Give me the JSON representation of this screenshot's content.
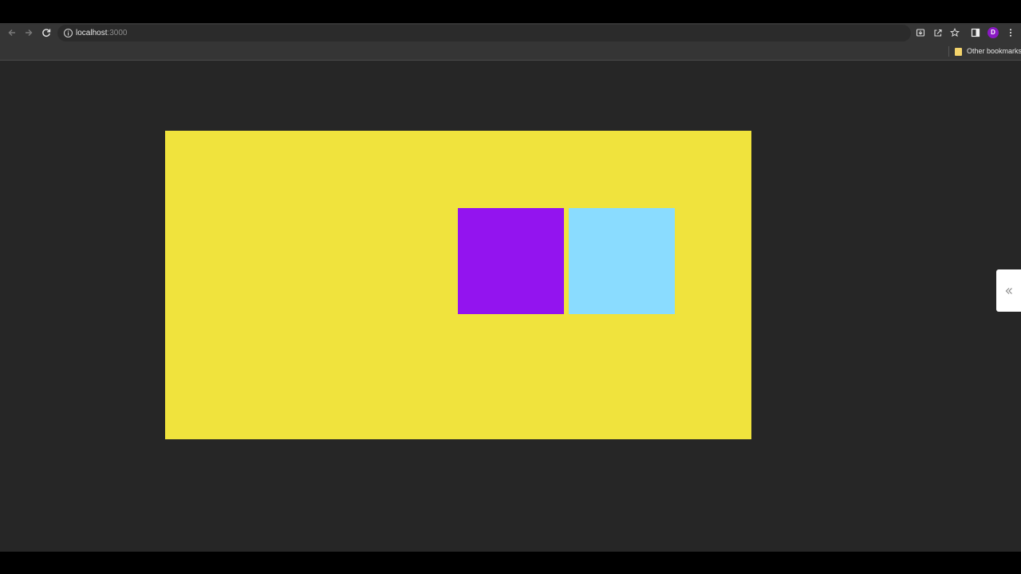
{
  "browser": {
    "url_host": "localhost",
    "url_port": ":3000",
    "bookmarks": {
      "other_label": "Other bookmarks"
    },
    "profile_initial": "D",
    "icons": {
      "back": "arrow-left-icon",
      "forward": "arrow-right-icon",
      "reload": "reload-icon",
      "site_info": "info-icon",
      "install": "install-icon",
      "share": "share-icon",
      "bookmark": "star-icon",
      "side_panel": "side-panel-icon",
      "menu": "kebab-menu-icon",
      "folder": "folder-icon"
    }
  },
  "page": {
    "side_tab_icon": "double-chevron-left-icon",
    "colors": {
      "background": "#262626",
      "container": "#f0e33d",
      "square_1": "#9314ef",
      "square_2": "#8adcff"
    }
  }
}
